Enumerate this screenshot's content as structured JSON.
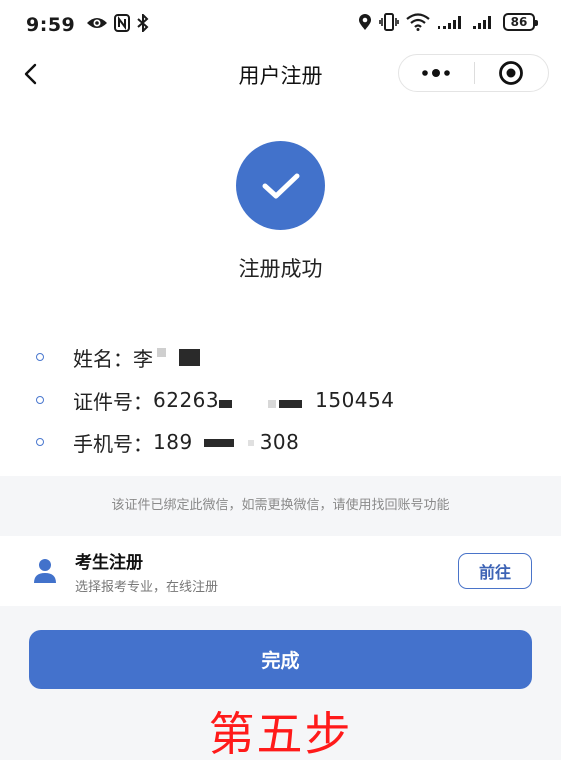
{
  "status_bar": {
    "time": "9:59",
    "battery": "86",
    "icons": [
      "eye-icon",
      "nfc-icon",
      "bluetooth-icon",
      "location-icon",
      "vibrate-icon",
      "wifi-icon",
      "signal-icon",
      "signal-icon"
    ]
  },
  "nav": {
    "title": "用户注册",
    "back_icon": "chevron-left-icon",
    "menu_icon": "more-dots-icon",
    "close_icon": "target-circle-icon"
  },
  "success": {
    "icon": "check-icon",
    "text": "注册成功"
  },
  "info": {
    "name_label": "姓名：",
    "name_value": "李",
    "id_label": "证件号：",
    "id_prefix": "62263",
    "id_suffix": "150454",
    "phone_label": "手机号：",
    "phone_prefix": "189",
    "phone_suffix": "308"
  },
  "notice": "该证件已绑定此微信，如需更换微信，请使用找回账号功能",
  "candidate": {
    "icon": "person-icon",
    "title": "考生注册",
    "subtitle": "选择报考专业，在线注册",
    "goto_label": "前往"
  },
  "done_label": "完成",
  "step_caption": "第五步",
  "colors": {
    "primary": "#4472cc",
    "caption_red": "#ff1a1a",
    "page_background": "#f5f6f8"
  }
}
